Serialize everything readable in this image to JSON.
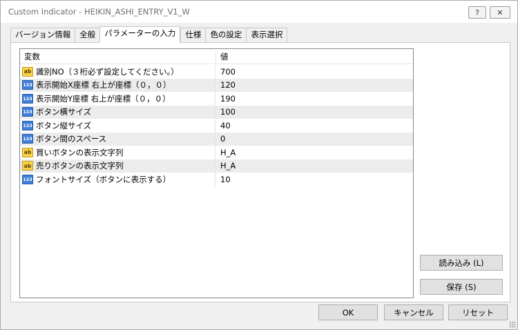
{
  "window": {
    "title": "Custom Indicator - HEIKIN_ASHI_ENTRY_V1_W",
    "help_label": "?",
    "close_label": "✕"
  },
  "tabs": [
    {
      "label": "バージョン情報"
    },
    {
      "label": "全般"
    },
    {
      "label": "パラメーターの入力"
    },
    {
      "label": "仕様"
    },
    {
      "label": "色の設定"
    },
    {
      "label": "表示選択"
    }
  ],
  "grid": {
    "header_variable": "変数",
    "header_value": "値",
    "rows": [
      {
        "icon": "ab",
        "name": "識別NO（３桁必ず設定してください。）",
        "value": "700"
      },
      {
        "icon": "123",
        "name": "表示開始X座標 右上が座標（０，０）",
        "value": "120"
      },
      {
        "icon": "123",
        "name": "表示開始Y座標 右上が座標（０，０）",
        "value": "190"
      },
      {
        "icon": "123",
        "name": "ボタン横サイズ",
        "value": "100"
      },
      {
        "icon": "123",
        "name": "ボタン縦サイズ",
        "value": "40"
      },
      {
        "icon": "123",
        "name": "ボタン間のスペース",
        "value": "0"
      },
      {
        "icon": "ab",
        "name": "買いボタンの表示文字列",
        "value": "H_A"
      },
      {
        "icon": "ab",
        "name": "売りボタンの表示文字列",
        "value": "H_A"
      },
      {
        "icon": "123",
        "name": "フォントサイズ（ボタンに表示する）",
        "value": "10"
      }
    ]
  },
  "side": {
    "load_label": "読み込み (L)",
    "save_label": "保存 (S)"
  },
  "footer": {
    "ok_label": "OK",
    "cancel_label": "キャンセル",
    "reset_label": "リセット"
  }
}
